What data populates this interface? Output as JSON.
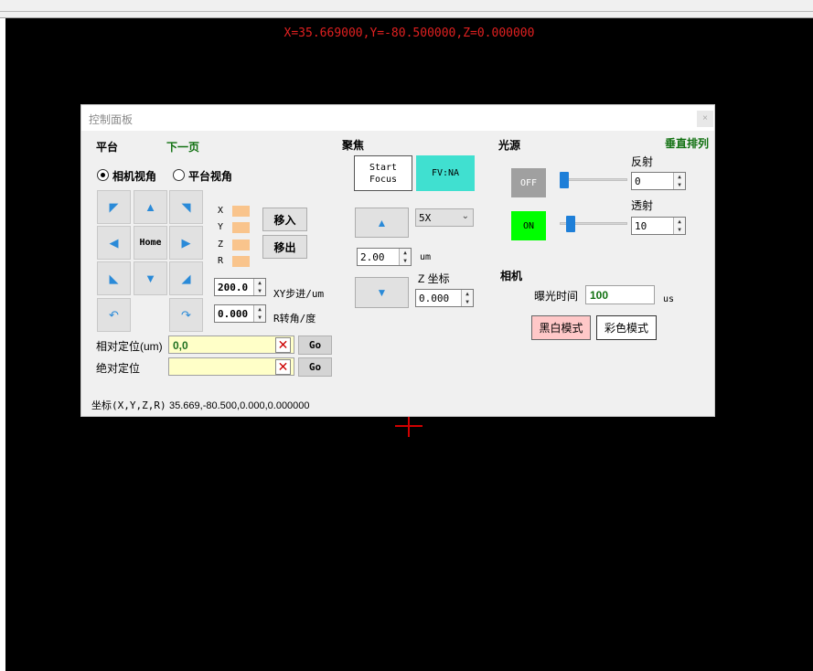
{
  "overlay": {
    "coords": "X=35.669000,Y=-80.500000,Z=0.000000"
  },
  "panel": {
    "title": "控制面板",
    "close": "×"
  },
  "platform": {
    "heading": "平台",
    "next_page": "下一页",
    "view_camera": "相机视角",
    "view_platform": "平台视角",
    "home": "Home",
    "axes": [
      "X",
      "Y",
      "Z",
      "R"
    ],
    "move_in": "移入",
    "move_out": "移出",
    "xy_step_value": "200.0",
    "xy_step_label": "XY步进/um",
    "r_angle_value": "0.000",
    "r_angle_label": "R转角/度",
    "relative_label": "相对定位(um)",
    "relative_value": "0,0",
    "absolute_label": "绝对定位",
    "absolute_value": "",
    "go": "Go",
    "coord_label": "坐标(X,Y,Z,R)",
    "coord_value": "35.669,-80.500,0.000,0.000000"
  },
  "focus": {
    "heading": "聚焦",
    "start_focus": "Start Focus",
    "fv_na": "FV:NA",
    "objective": "5X",
    "step_value": "2.00",
    "step_unit": "um",
    "z_label": "Z 坐标",
    "z_value": "0.000"
  },
  "light": {
    "heading": "光源",
    "vertical": "垂直排列",
    "off": "OFF",
    "on": "ON",
    "reflect_label": "反射",
    "reflect_value": "0",
    "transmit_label": "透射",
    "transmit_value": "10",
    "reflect_level": 0,
    "transmit_level": 10
  },
  "camera": {
    "heading": "相机",
    "exposure_label": "曝光时间",
    "exposure_value": "100",
    "exposure_unit": "us",
    "mono_mode": "黑白模式",
    "color_mode": "彩色模式"
  },
  "colors": {
    "on_green": "#00ff00",
    "off_gray": "#a0a0a0",
    "fv_cyan": "#40e0d0",
    "mono_pink": "#ffc8c8",
    "coords_red": "#e02020"
  }
}
